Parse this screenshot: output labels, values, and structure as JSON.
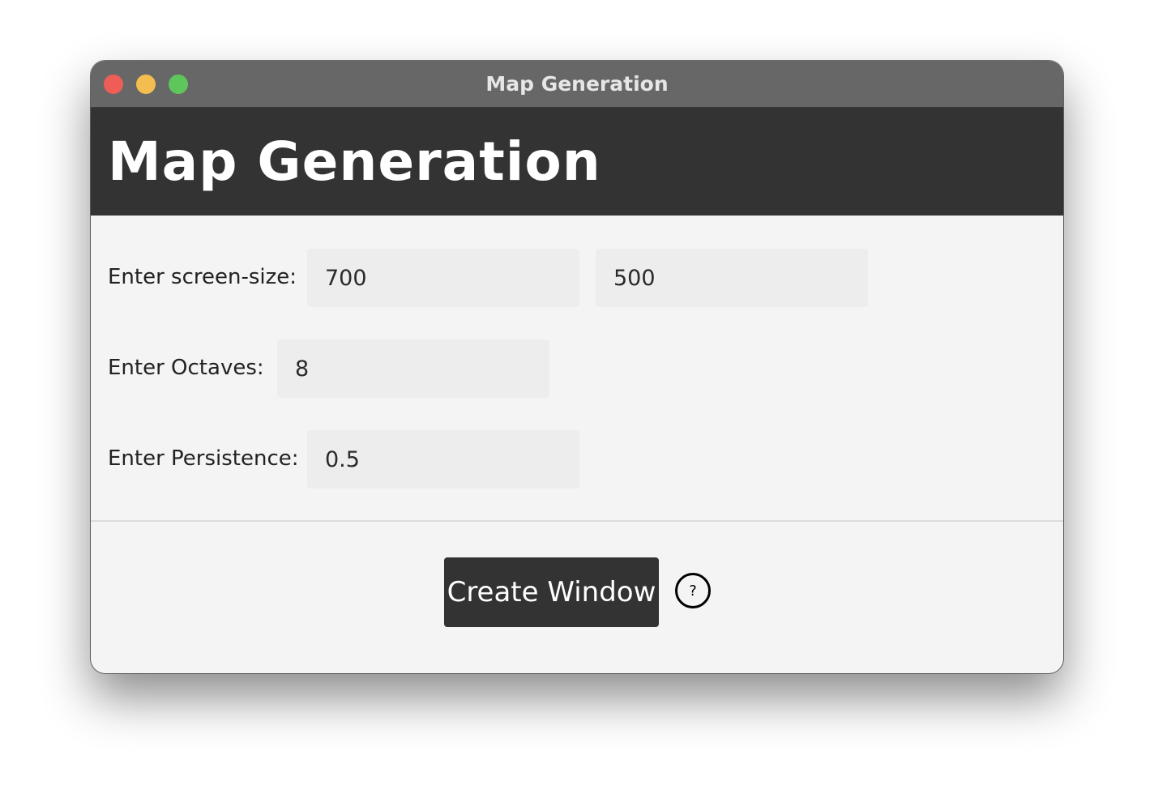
{
  "window": {
    "title": "Map Generation"
  },
  "header": {
    "title": "Map Generation"
  },
  "form": {
    "screen_size": {
      "label": "Enter screen-size:",
      "width_value": "700",
      "height_value": "500"
    },
    "octaves": {
      "label": "Enter Octaves:",
      "value": "8"
    },
    "persistence": {
      "label": "Enter Persistence:",
      "value": "0.5"
    }
  },
  "actions": {
    "create_label": "Create Window",
    "help_label": "?"
  },
  "colors": {
    "titlebar": "#676767",
    "header": "#333333",
    "button": "#333333",
    "content_bg": "#f4f4f4",
    "close": "#ee5e56",
    "minimize": "#f4bd4f",
    "zoom": "#5fc65c"
  }
}
